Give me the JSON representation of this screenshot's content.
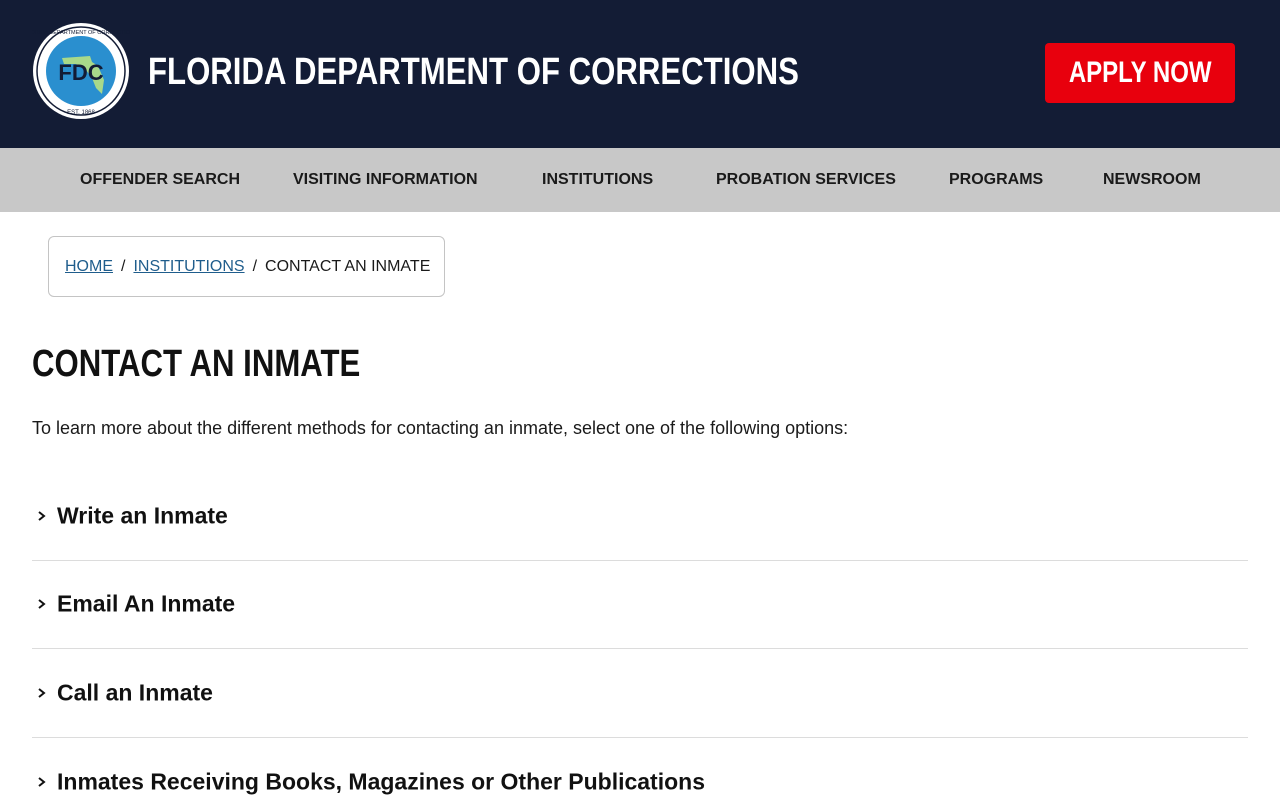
{
  "header": {
    "logo_alt": "FLORIDA DEPARTMENT OF CORRECTIONS seal",
    "logo_ring_text": "FLORIDA DEPARTMENT OF CORRECTIONS",
    "logo_initials": "FDC",
    "logo_est": "EST. 1868",
    "title": "FLORIDA DEPARTMENT OF CORRECTIONS",
    "apply_label": "APPLY NOW"
  },
  "nav": {
    "items": [
      {
        "label": "OFFENDER SEARCH"
      },
      {
        "label": "VISITING INFORMATION"
      },
      {
        "label": "INSTITUTIONS"
      },
      {
        "label": "PROBATION SERVICES"
      },
      {
        "label": "PROGRAMS"
      },
      {
        "label": "NEWSROOM"
      }
    ]
  },
  "breadcrumb": {
    "home": "HOME",
    "institutions": "INSTITUTIONS",
    "current": "CONTACT AN INMATE",
    "separator": "/"
  },
  "page": {
    "title": "CONTACT AN INMATE",
    "intro": "To learn more about the different methods for contacting an inmate, select one of the following options:"
  },
  "accordion": {
    "items": [
      {
        "label": "Write an Inmate"
      },
      {
        "label": "Email An Inmate"
      },
      {
        "label": "Call an Inmate"
      },
      {
        "label": "Inmates Receiving Books, Magazines or Other Publications"
      }
    ]
  },
  "colors": {
    "header_bg": "#131c35",
    "nav_bg": "#c8c8c8",
    "apply_bg": "#e8000d",
    "link": "#1f5d8c"
  },
  "icons": {
    "accordion": "chevron-right-icon"
  }
}
